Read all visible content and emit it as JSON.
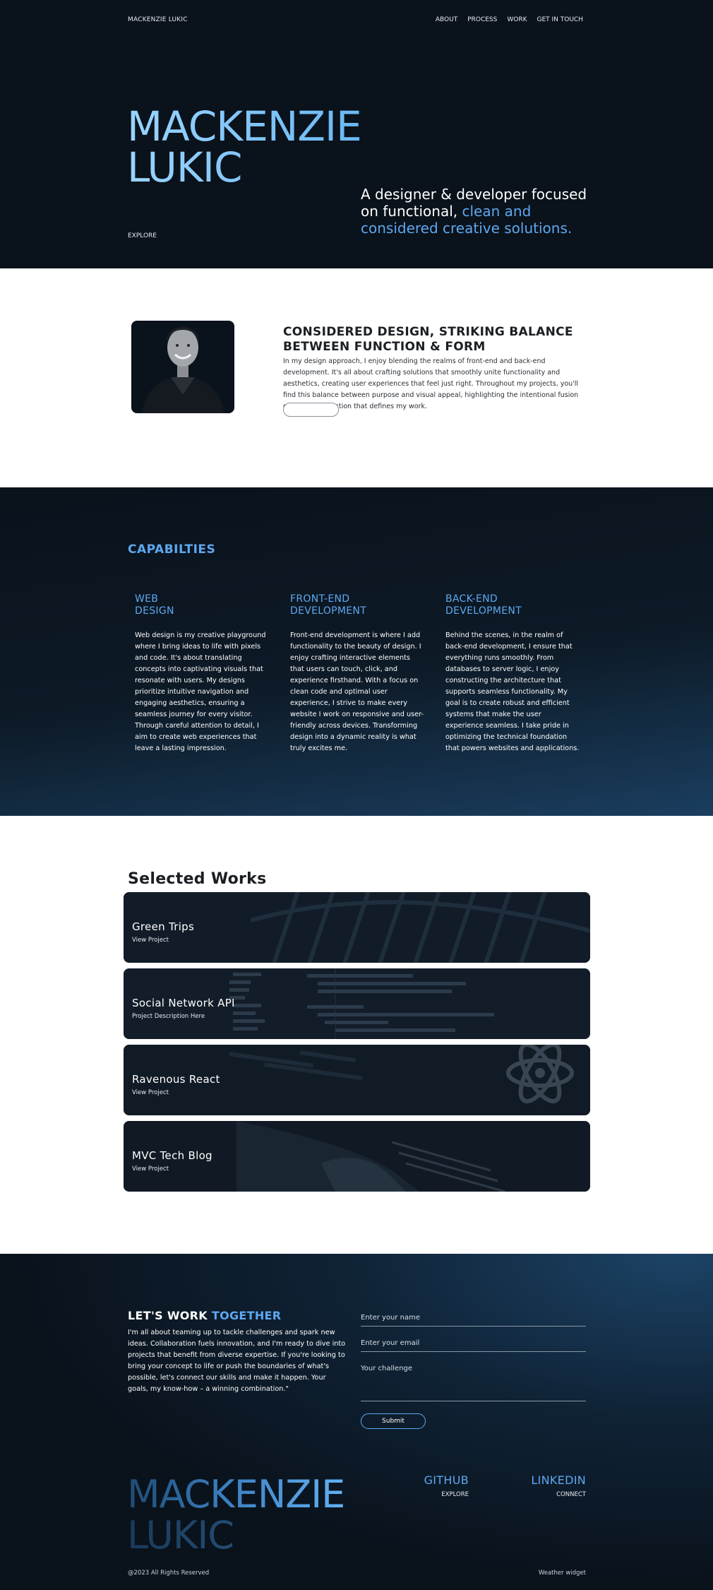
{
  "nav": {
    "logo": "MACKENZIE LUKIC",
    "items": [
      "ABOUT",
      "PROCESS",
      "WORK",
      "GET IN TOUCH"
    ]
  },
  "hero": {
    "name_line1": "MACKENZIE",
    "name_line2": "LUKIC",
    "tagline_plain": "A designer & developer focused on functional, ",
    "tagline_accent": "clean and considered creative solutions.",
    "explore": "EXPLORE"
  },
  "about": {
    "title": "CONSIDERED DESIGN, STRIKING BALANCE BETWEEN FUNCTION & FORM",
    "text": "In my design approach, I enjoy blending the realms of front-end and back-end development. It's all about crafting solutions that smoothly unite functionality and aesthetics, creating user experiences that feel just right. Throughout my projects, you'll find this balance between purpose and visual appeal, highlighting the intentional fusion of form and function that defines my work.",
    "button_label": ""
  },
  "capabilities": {
    "title": "CAPABILTIES",
    "items": [
      {
        "title_line1": "WEB",
        "title_line2": "DESIGN",
        "text": "Web design is my creative playground where I bring ideas to life with pixels and code. It's about translating concepts into captivating visuals that resonate with users. My designs prioritize intuitive navigation and engaging aesthetics, ensuring a seamless journey for every visitor. Through careful attention to detail, I aim to create web experiences that leave a lasting impression."
      },
      {
        "title_line1": "FRONT-END",
        "title_line2": "DEVELOPMENT",
        "text": "Front-end development is where I add functionality to the beauty of design. I enjoy crafting interactive elements that users can touch, click, and experience firsthand. With a focus on clean code and optimal user experience, I strive to make every website I work on responsive and user-friendly across devices. Transforming design into a dynamic reality is what truly excites me."
      },
      {
        "title_line1": "BACK-END",
        "title_line2": "DEVELOPMENT",
        "text": "Behind the scenes, in the realm of back-end development, I ensure that everything runs smoothly. From databases to server logic, I enjoy constructing the architecture that supports seamless functionality. My goal is to create robust and efficient systems that make the user experience seamless. I take pride in optimizing the technical foundation that powers websites and applications."
      }
    ]
  },
  "works": {
    "title": "Selected Works",
    "projects": [
      {
        "title": "Green Trips",
        "subtitle": "View Project"
      },
      {
        "title": "Social Network API",
        "subtitle": "Project Description Here"
      },
      {
        "title": "Ravenous React",
        "subtitle": "View Project"
      },
      {
        "title": "MVC Tech Blog",
        "subtitle": "View Project"
      }
    ]
  },
  "contact": {
    "title_plain": "LET'S WORK ",
    "title_accent": "TOGETHER",
    "text": "I'm all about teaming up to tackle challenges and spark new ideas. Collaboration fuels innovation, and I'm ready to dive into projects that benefit from diverse expertise. If you're looking to bring your concept to life or push the boundaries of what's possible, let's connect our skills and make it happen. Your goals, my know-how – a winning combination.\"",
    "name_placeholder": "Enter your name",
    "email_placeholder": "Enter your email",
    "challenge_placeholder": "Your challenge",
    "submit": "Submit"
  },
  "footer": {
    "name_line1": "MACKENZIE",
    "name_line2": "LUKIC",
    "github": "GITHUB",
    "github_sub": "EXPLORE",
    "linkedin": "LINKEDIN",
    "linkedin_sub": "CONNECT",
    "copyright": "@2023 All Rights Reserved",
    "weather": "Weather widget"
  },
  "colors": {
    "background_dark": "#0a121b",
    "accent_blue": "#5ea8f0",
    "hero_name_light_blue": "#9ad4ff"
  }
}
